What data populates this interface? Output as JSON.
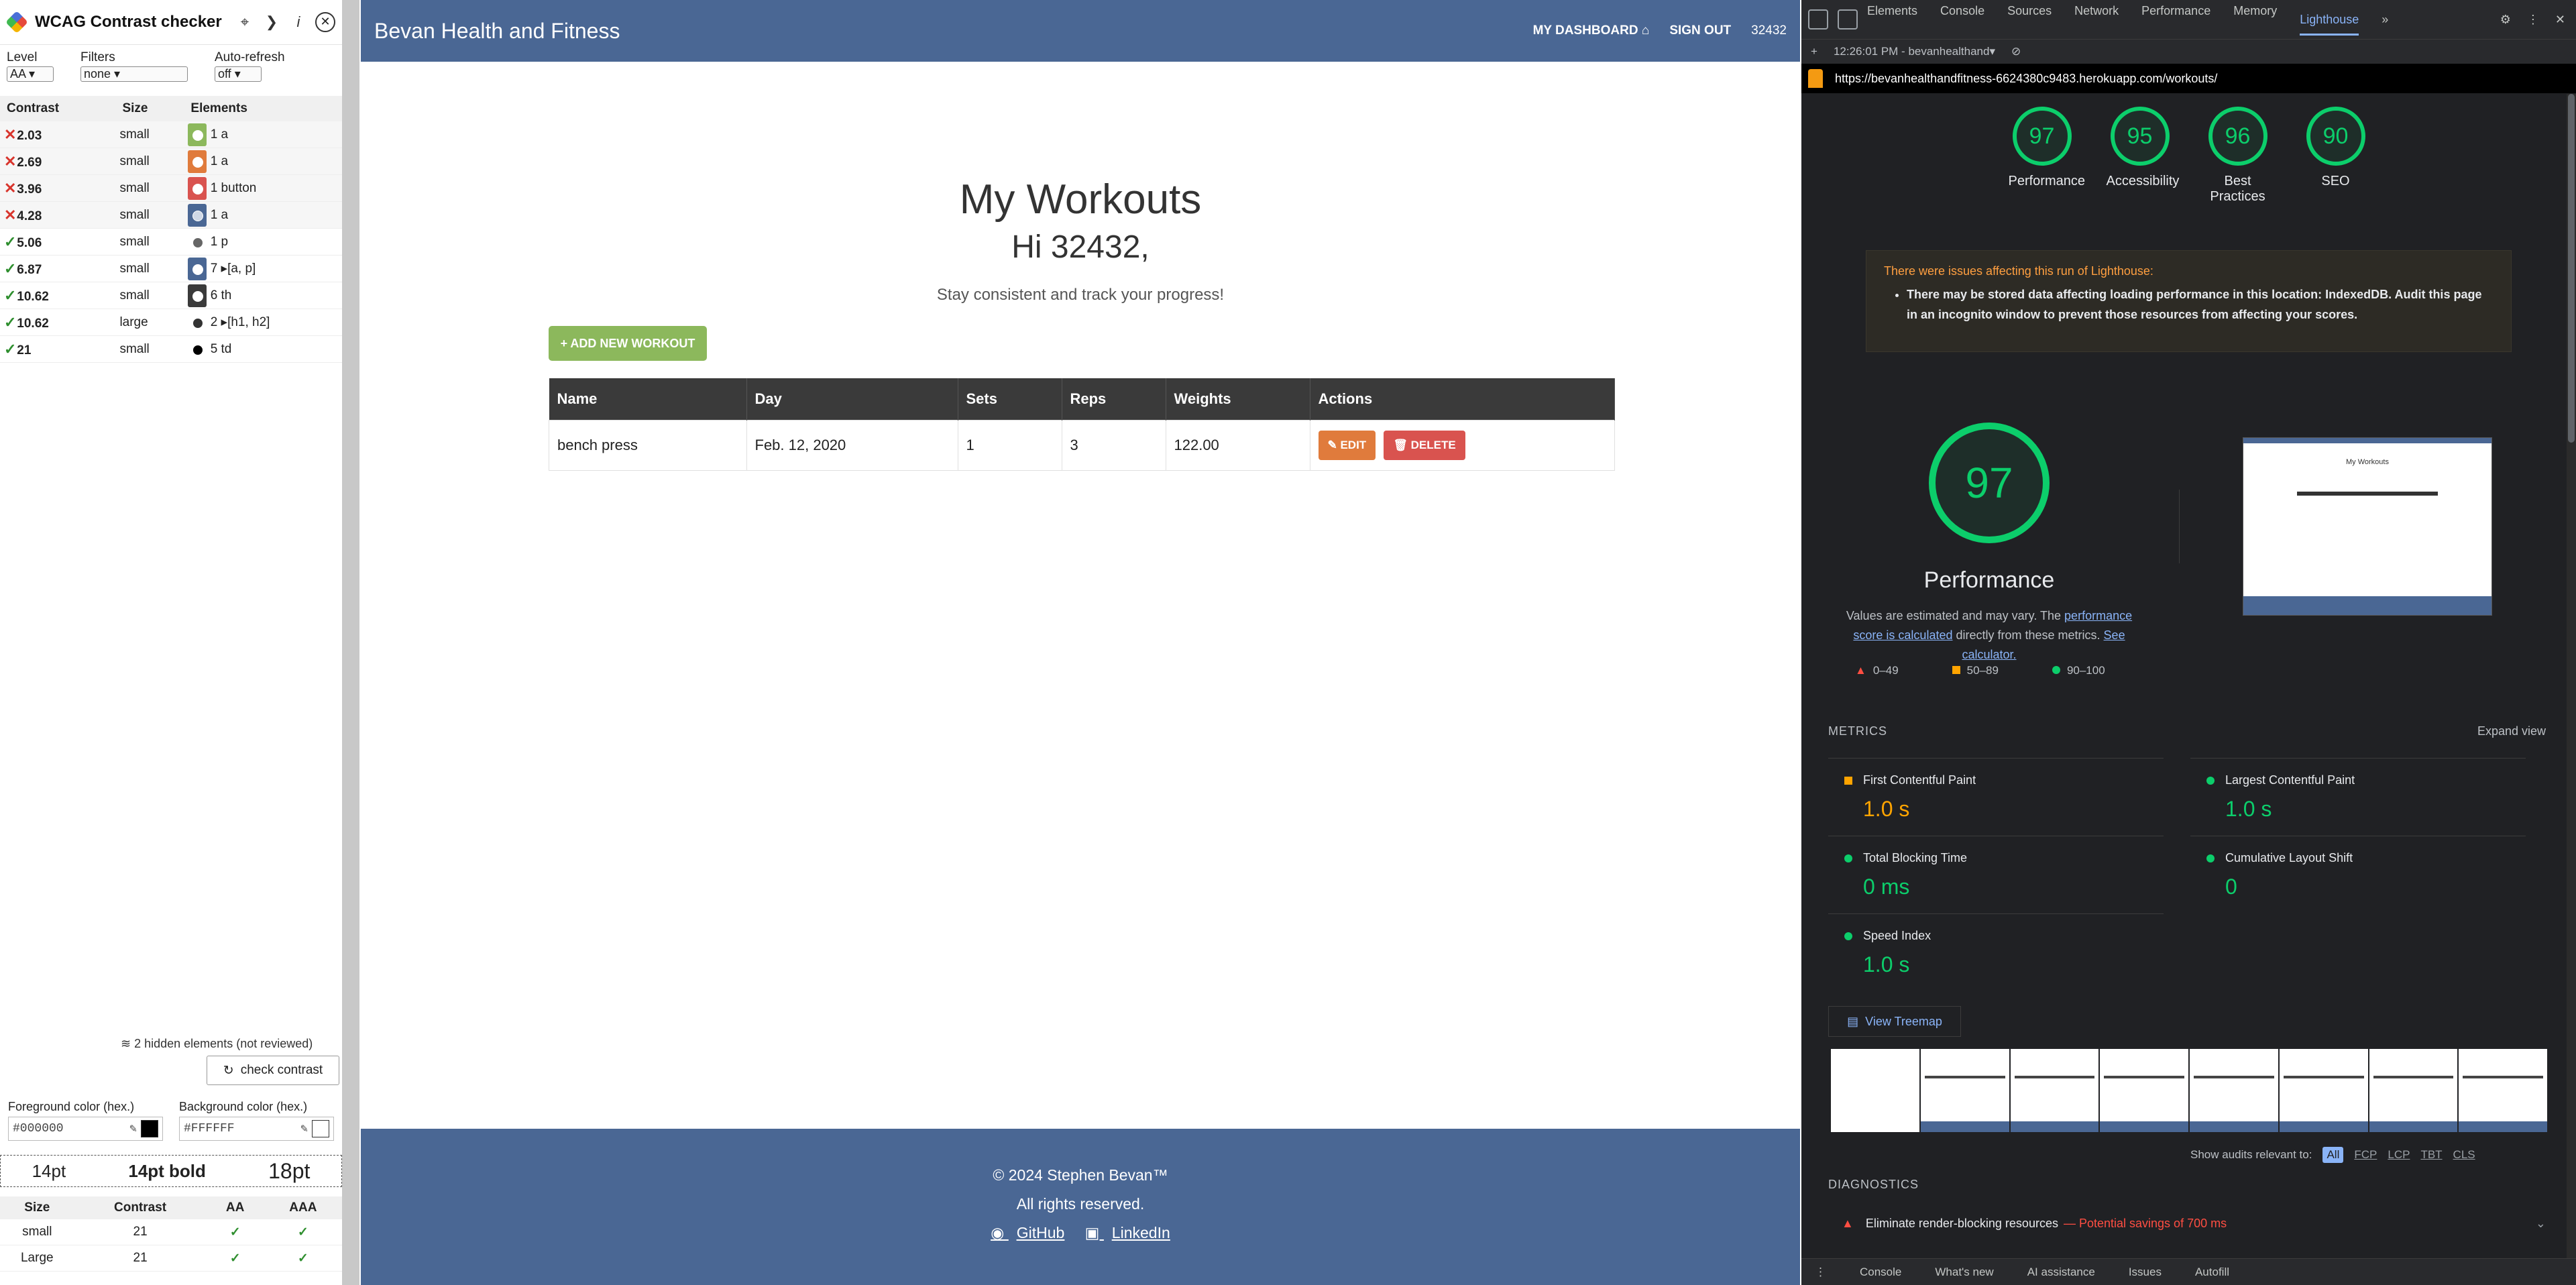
{
  "wcag": {
    "title": "WCAG Contrast checker",
    "level_label": "Level",
    "level_value": "AA",
    "filters_label": "Filters",
    "filters_value": "none",
    "autorefresh_label": "Auto-refresh",
    "autorefresh_value": "off",
    "columns": [
      "Contrast",
      "Size",
      "Elements"
    ],
    "rows": [
      {
        "ratio": "2.03",
        "size": "small",
        "elements": "1 a",
        "pass": false,
        "bg": "#8cb85c",
        "fg": "#ffffff"
      },
      {
        "ratio": "2.69",
        "size": "small",
        "elements": "1 a",
        "pass": false,
        "bg": "#e07b3c",
        "fg": "#ffffff"
      },
      {
        "ratio": "3.96",
        "size": "small",
        "elements": "1 button",
        "pass": false,
        "bg": "#d9534f",
        "fg": "#ffffff"
      },
      {
        "ratio": "4.28",
        "size": "small",
        "elements": "1 a",
        "pass": false,
        "bg": "#4a6794",
        "fg": "#cfd8e6"
      },
      {
        "ratio": "5.06",
        "size": "small",
        "elements": "1 p",
        "pass": true,
        "bg": "#ffffff",
        "fg": "#666666"
      },
      {
        "ratio": "6.87",
        "size": "small",
        "elements": "7 ▸[a, p]",
        "pass": true,
        "bg": "#4a6794",
        "fg": "#ffffff"
      },
      {
        "ratio": "10.62",
        "size": "small",
        "elements": "6 th",
        "pass": true,
        "bg": "#3a3a3a",
        "fg": "#ffffff"
      },
      {
        "ratio": "10.62",
        "size": "large",
        "elements": "2 ▸[h1, h2]",
        "pass": true,
        "bg": "#ffffff",
        "fg": "#333333"
      },
      {
        "ratio": "21",
        "size": "small",
        "elements": "5 td",
        "pass": true,
        "bg": "#ffffff",
        "fg": "#000000"
      }
    ],
    "hidden_note": "2 hidden elements (not reviewed)",
    "check_button": "check contrast",
    "fg_label": "Foreground color (hex.)",
    "fg_value": "#000000",
    "bg_label": "Background color (hex.)",
    "bg_value": "#FFFFFF",
    "sizes": [
      "14pt",
      "14pt bold",
      "18pt"
    ],
    "summary_columns": [
      "Size",
      "Contrast",
      "AA",
      "AAA"
    ],
    "summary_rows": [
      {
        "size": "small",
        "contrast": "21"
      },
      {
        "size": "Large",
        "contrast": "21"
      }
    ]
  },
  "site": {
    "brand": "Bevan Health and Fitness",
    "nav_dashboard": "MY DASHBOARD",
    "nav_signout": "SIGN OUT",
    "nav_user": "32432",
    "heading": "My Workouts",
    "greeting": "Hi 32432,",
    "tagline": "Stay consistent and track your progress!",
    "add_button": "+ ADD NEW WORKOUT",
    "table_headers": [
      "Name",
      "Day",
      "Sets",
      "Reps",
      "Weights",
      "Actions"
    ],
    "rows": [
      {
        "name": "bench press",
        "day": "Feb. 12, 2020",
        "sets": "1",
        "reps": "3",
        "weights": "122.00"
      }
    ],
    "edit_label": "EDIT",
    "delete_label": "DELETE",
    "footer_copyright": "© 2024 Stephen Bevan™",
    "footer_rights": "All rights reserved.",
    "footer_github": "GitHub",
    "footer_linkedin": "LinkedIn",
    "colors": {
      "nav": "#4a6794",
      "add": "#8cb85c",
      "edit": "#e07b3c",
      "delete": "#d9534f"
    }
  },
  "devtools": {
    "tabs": [
      "Elements",
      "Console",
      "Sources",
      "Network",
      "Performance",
      "Memory",
      "Lighthouse"
    ],
    "active_tab": "Lighthouse",
    "report_time": "12:26:01 PM - bevanhealthand▾",
    "url": "https://bevanhealthandfitness-6624380c9483.herokuapp.com/workouts/",
    "gauges": [
      {
        "score": "97",
        "label": "Performance"
      },
      {
        "score": "95",
        "label": "Accessibility"
      },
      {
        "score": "96",
        "label": "Best Practices"
      },
      {
        "score": "90",
        "label": "SEO"
      }
    ],
    "warning_head": "There were issues affecting this run of Lighthouse:",
    "warning_item": "There may be stored data affecting loading performance in this location: IndexedDB. Audit this page in an incognito window to prevent those resources from affecting your scores.",
    "perf_score": "97",
    "perf_title": "Performance",
    "perf_note_a": "Values are estimated and may vary. The ",
    "perf_note_link1": "performance score is calculated",
    "perf_note_b": " directly from these metrics. ",
    "perf_note_link2": "See calculator.",
    "legend": [
      "0–49",
      "50–89",
      "90–100"
    ],
    "metrics_label": "METRICS",
    "expand_label": "Expand view",
    "metrics": [
      {
        "name": "First Contentful Paint",
        "value": "1.0 s",
        "status": "orange"
      },
      {
        "name": "Largest Contentful Paint",
        "value": "1.0 s",
        "status": "green"
      },
      {
        "name": "Total Blocking Time",
        "value": "0 ms",
        "status": "green"
      },
      {
        "name": "Cumulative Layout Shift",
        "value": "0",
        "status": "green"
      },
      {
        "name": "Speed Index",
        "value": "1.0 s",
        "status": "green"
      }
    ],
    "treemap_label": "View Treemap",
    "relevant_label": "Show audits relevant to:",
    "relevant_filters": [
      "All",
      "FCP",
      "LCP",
      "TBT",
      "CLS"
    ],
    "diagnostics_label": "DIAGNOSTICS",
    "audit_name": "Eliminate render-blocking resources",
    "audit_savings": "— Potential savings of 700 ms",
    "drawer_tabs": [
      "Console",
      "What's new",
      "AI assistance",
      "Issues",
      "Autofill"
    ],
    "screenshot_title": "My Workouts"
  }
}
